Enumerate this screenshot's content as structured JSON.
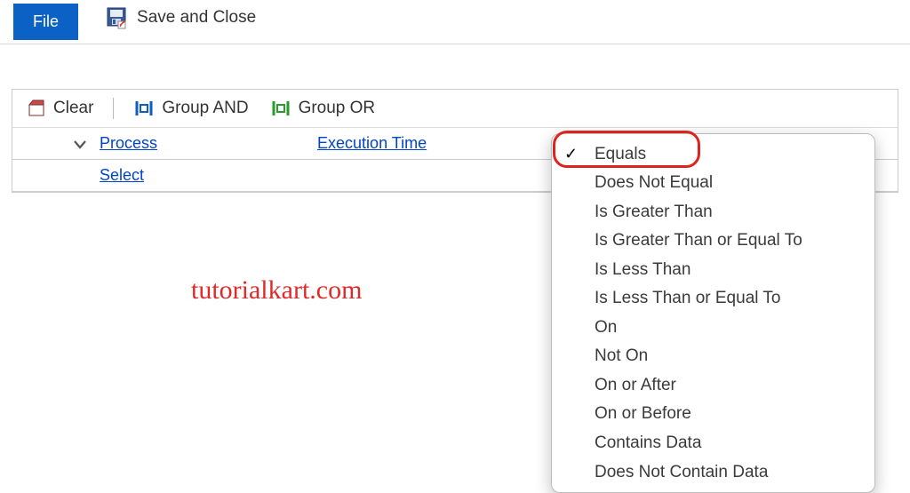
{
  "toolbar": {
    "file_label": "File",
    "save_close_label": "Save and Close"
  },
  "filter_bar": {
    "clear_label": "Clear",
    "group_and_label": "Group AND",
    "group_or_label": "Group OR"
  },
  "row1": {
    "process_label": "Process",
    "exec_time_label": "Execution Time"
  },
  "row2": {
    "select_label": "Select"
  },
  "watermark": "tutorialkart.com",
  "dropdown": {
    "items": [
      "Equals",
      "Does Not Equal",
      "Is Greater Than",
      "Is Greater Than or Equal To",
      "Is Less Than",
      "Is Less Than or Equal To",
      "On",
      "Not On",
      "On or After",
      "On or Before",
      "Contains Data",
      "Does Not Contain Data"
    ],
    "selected_index": 0
  }
}
